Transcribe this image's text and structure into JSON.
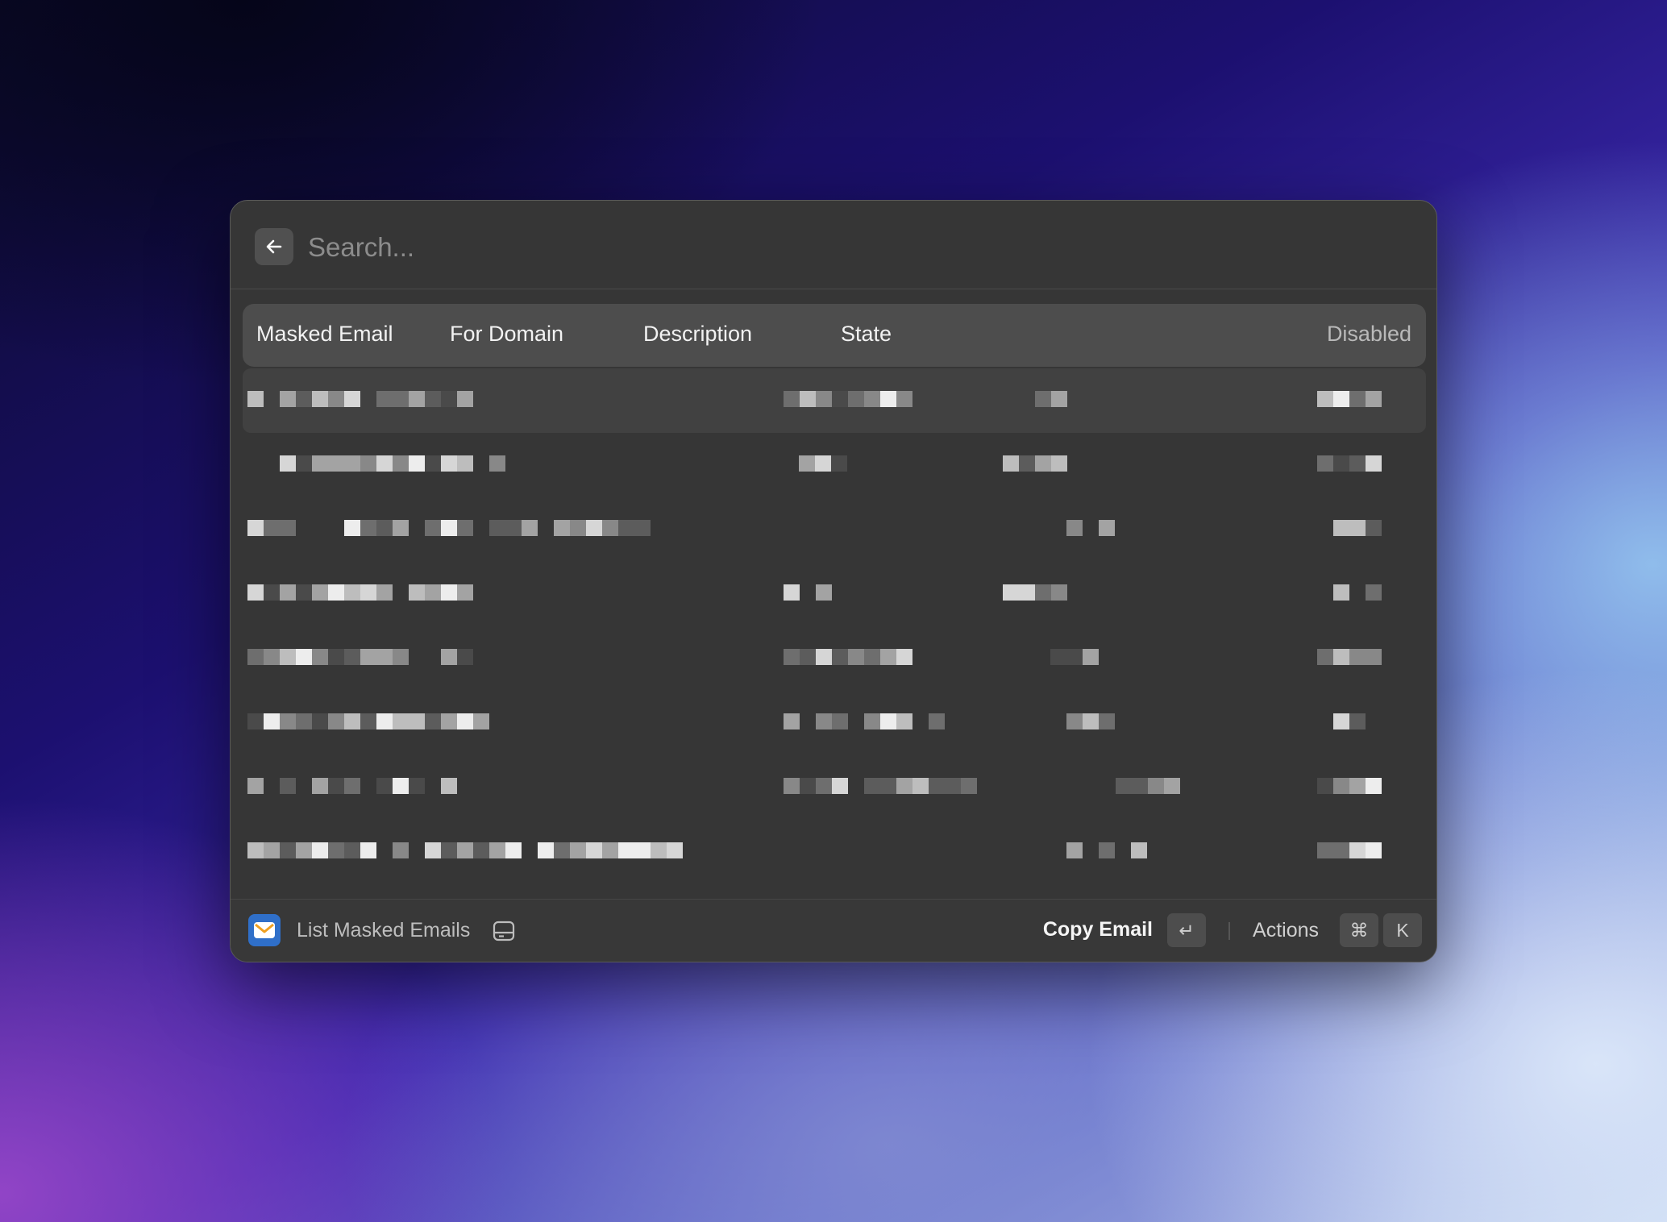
{
  "search": {
    "placeholder": "Search..."
  },
  "table": {
    "columns": [
      "Masked Email",
      "For Domain",
      "Description",
      "State",
      "Disabled"
    ],
    "rows_note_redacted": true,
    "row_count": 8
  },
  "footer": {
    "command_title": "List Masked Emails",
    "primary_action": "Copy Email",
    "primary_shortcut": "↵",
    "actions_label": "Actions",
    "actions_shortcut": [
      "⌘",
      "K"
    ]
  },
  "icons": {
    "back": "arrow-left-icon",
    "app": "mail-app-icon",
    "storage": "local-storage-icon"
  },
  "colors": {
    "window_bg": "#363636",
    "header_bg": "#4d4d4d",
    "selected_row_bg": "#414141",
    "app_icon": "#2f6fc9"
  }
}
